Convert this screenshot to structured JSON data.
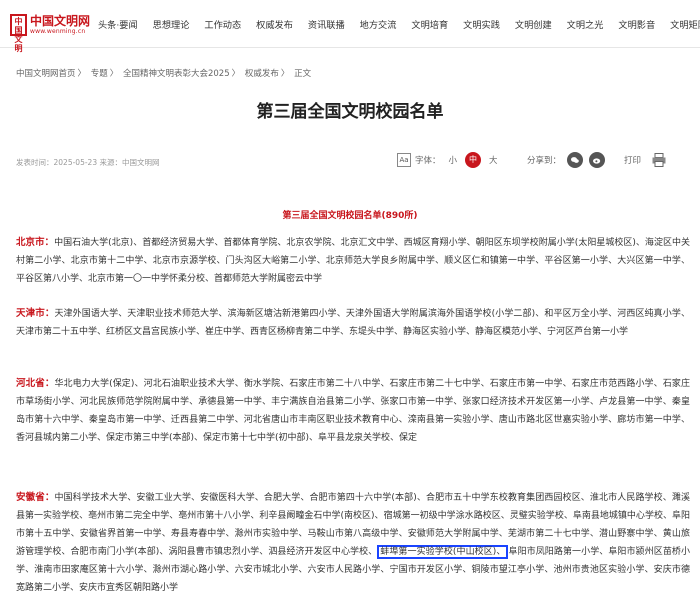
{
  "brand": {
    "seal": "中国\n文明网",
    "name": "中国文明网",
    "url": "www.wenming.cn",
    "color": "#c8161d"
  },
  "nav": [
    "头条·要闻",
    "思想理论",
    "工作动态",
    "权威发布",
    "资讯联播",
    "地方交流",
    "文明培育",
    "文明实践",
    "文明创建",
    "文明之光",
    "文明影音",
    "文明矩阵"
  ],
  "breadcrumb": [
    "中国文明网首页",
    "专题",
    "全国精神文明表彰大会2025",
    "权威发布",
    "正文"
  ],
  "article": {
    "title": "第三届全国文明校园名单",
    "meta": "发表时间：2025-05-23  来源：中国文明网",
    "font_label": "字体：",
    "font_small": "小",
    "font_medium": "中",
    "font_large": "大",
    "share_label": "分享到：",
    "print_label": "打印"
  },
  "content": {
    "heading": "第三届全国文明校园名单(890所)",
    "sections": [
      {
        "province": "北京市：",
        "text": "中国石油大学(北京)、首都经济贸易大学、首都体育学院、北京农学院、北京汇文中学、西城区育翔小学、朝阳区东坝学校附属小学(太阳星城校区)、海淀区中关村第二小学、北京市第十二中学、北京市京源学校、门头沟区大峪第二小学、北京师范大学良乡附属中学、顺义区仁和镇第一中学、平谷区第一小学、大兴区第一中学、平谷区第八小学、北京市第一〇一中学怀柔分校、首都师范大学附属密云中学"
      },
      {
        "province": "天津市：",
        "text": "天津外国语大学、天津职业技术师范大学、滨海新区塘沽新港第四小学、天津外国语大学附属滨海外国语学校(小学二部)、和平区万全小学、河西区纯真小学、天津市第二十五中学、红桥区文昌宫民族小学、崔庄中学、西青区杨柳青第二中学、东堤头中学、静海区实验小学、静海区模范小学、宁河区芦台第一小学"
      },
      {
        "province": "河北省：",
        "text": "华北电力大学(保定)、河北石油职业技术大学、衡水学院、石家庄市第二十八中学、石家庄市第二十七中学、石家庄市第一中学、石家庄市范西路小学、石家庄市草场街小学、河北民族师范学院附属中学、承德县第一中学、丰宁满族自治县第二小学、张家口市第一中学、张家口经济技术开发区第一小学、卢龙县第一中学、秦皇岛市第十六中学、秦皇岛市第一中学、迁西县第二中学、河北省唐山市丰南区职业技术教育中心、滦南县第一实验小学、唐山市路北区世嘉实验小学、廊坊市第一中学、香河县城内第二小学、保定市第三中学(本部)、保定市第十七中学(初中部)、阜平县龙泉关学校、保定"
      },
      {
        "province": "安徽省：",
        "text_before": "中国科学技术大学、安徽工业大学、安徽医科大学、合肥大学、合肥市第四十六中学(本部)、合肥市五十中学东校教育集团西园校区、淮北市人民路学校、濉溪县第一实验学校、亳州市第二完全中学、亳州市第十八小学、利辛县阚疃金石中学(南校区)、宿城第一初级中学涂水路校区、灵璧实验学校、阜南县地城镇中心学校、阜阳市第十五中学、安徽省界首第一中学、寿县寿春中学、滁州市实验中学、马鞍山市第八高级中学、安徽师范大学附属中学、芜湖市第二十七中学、潜山野寨中学、黄山旅游管理学校、合肥市南门小学(本部)、涡阳县曹市镇忠烈小学、泗县经济开发区中心学校、",
        "highlight": "蚌埠第一实验学校(中山校区)、",
        "text_after": "阜阳市凤阳路第一小学、阜阳市颍州区苗桥小学、淮南市田家庵区第十六小学、滁州市湖心路小学、六安市城北小学、六安市人民路小学、宁国市开发区小学、铜陵市望江亭小学、池州市贵池区实验小学、安庆市德宽路第二小学、安庆市宜秀区朝阳路小学"
      }
    ]
  }
}
